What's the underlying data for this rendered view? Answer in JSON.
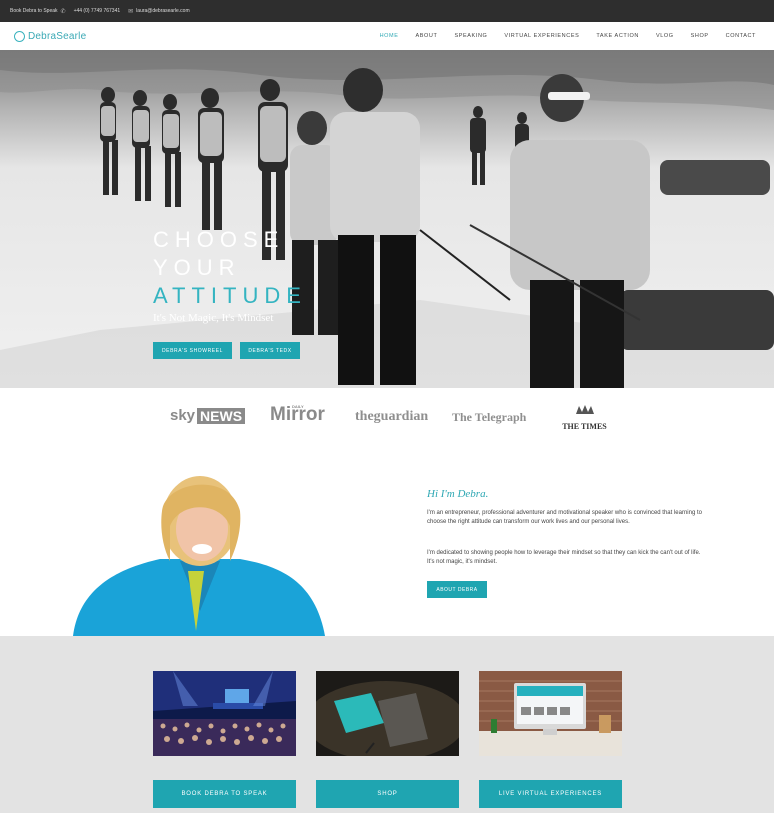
{
  "topbar": {
    "book_text": "Book Debra to Speak",
    "phone": "+44 (0) 7749 767341",
    "email": "laura@debrasearle.com"
  },
  "logo": {
    "first": "Debra",
    "second": "Searle"
  },
  "nav": {
    "items": [
      "HOME",
      "ABOUT",
      "SPEAKING",
      "VIRTUAL EXPERIENCES",
      "TAKE ACTION",
      "VLOG",
      "SHOP",
      "CONTACT"
    ],
    "active": "HOME"
  },
  "hero": {
    "title_line1": "CHOOSE",
    "title_line2": "YOUR",
    "title_line3": "ATTITUDE",
    "subtitle": "It's Not Magic, It's Mindset",
    "btn_showreel": "DEBRA'S SHOWREEL",
    "btn_tedx": "DEBRA'S TEDX"
  },
  "press": {
    "sky": "sky",
    "news": "NEWS",
    "mirror_small": "DAILY",
    "mirror": "Mirror",
    "guardian": "theguardian",
    "telegraph": "The Telegraph",
    "times": "THE TIMES"
  },
  "intro": {
    "heading": "Hi I'm Debra.",
    "para1": "I'm an entrepreneur, professional adventurer and motivational speaker who is convinced that learning to choose the right attitude can transform our work lives and our personal lives.",
    "para2": "I'm dedicated to showing people how to leverage their mindset so that they can kick the can't out of life. It's not magic, it's mindset.",
    "about_btn": "ABOUT DEBRA"
  },
  "cards": {
    "book": "BOOK DEBRA TO SPEAK",
    "shop": "SHOP",
    "live": "LIVE VIRTUAL EXPERIENCES"
  },
  "colors": {
    "accent": "#1fa5b1",
    "topbar": "#2e2e2e",
    "gray_band": "#e3e3e3"
  }
}
